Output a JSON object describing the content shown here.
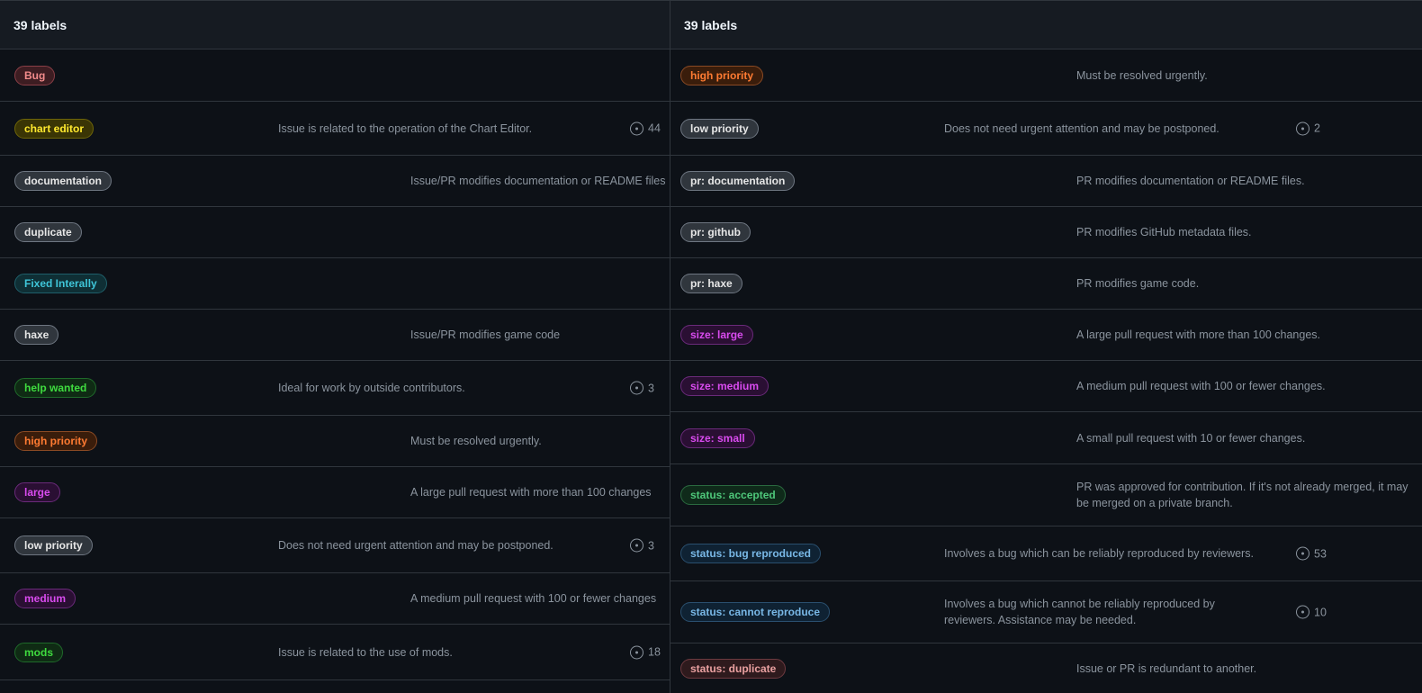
{
  "left_panel": {
    "title": "39 labels",
    "rows": [
      {
        "label": "Bug",
        "description": "",
        "count": ""
      },
      {
        "label": "chart editor",
        "description": "Issue is related to the operation of the Chart Editor.",
        "count": "44"
      },
      {
        "label": "documentation",
        "description": "Issue/PR modifies documentation or README files",
        "count": ""
      },
      {
        "label": "duplicate",
        "description": "",
        "count": ""
      },
      {
        "label": "Fixed Interally",
        "description": "",
        "count": ""
      },
      {
        "label": "haxe",
        "description": "Issue/PR modifies game code",
        "count": ""
      },
      {
        "label": "help wanted",
        "description": "Ideal for work by outside contributors.",
        "count": "3"
      },
      {
        "label": "high priority",
        "description": "Must be resolved urgently.",
        "count": ""
      },
      {
        "label": "large",
        "description": "A large pull request with more than 100 changes",
        "count": ""
      },
      {
        "label": "low priority",
        "description": "Does not need urgent attention and may be postponed.",
        "count": "3"
      },
      {
        "label": "medium",
        "description": "A medium pull request with 100 or fewer changes",
        "count": ""
      },
      {
        "label": "mods",
        "description": "Issue is related to the use of mods.",
        "count": "18"
      }
    ]
  },
  "right_panel": {
    "title": "39 labels",
    "rows": [
      {
        "label": "high priority",
        "description": "Must be resolved urgently.",
        "count": ""
      },
      {
        "label": "low priority",
        "description": "Does not need urgent attention and may be postponed.",
        "count": "2"
      },
      {
        "label": "pr: documentation",
        "description": "PR modifies documentation or README files.",
        "count": ""
      },
      {
        "label": "pr: github",
        "description": "PR modifies GitHub metadata files.",
        "count": ""
      },
      {
        "label": "pr: haxe",
        "description": "PR modifies game code.",
        "count": ""
      },
      {
        "label": "size: large",
        "description": "A large pull request with more than 100 changes.",
        "count": ""
      },
      {
        "label": "size: medium",
        "description": "A medium pull request with 100 or fewer changes.",
        "count": ""
      },
      {
        "label": "size: small",
        "description": "A small pull request with 10 or fewer changes.",
        "count": ""
      },
      {
        "label": "status: accepted",
        "description": "PR was approved for contribution. If it's not already merged, it may be merged on a private branch.",
        "count": ""
      },
      {
        "label": "status: bug reproduced",
        "description": "Involves a bug which can be reliably reproduced by reviewers.",
        "count": "53"
      },
      {
        "label": "status: cannot reproduce",
        "description": "Involves a bug which cannot be reliably reproduced by reviewers. Assistance may be needed.",
        "count": "10"
      },
      {
        "label": "status: duplicate",
        "description": "Issue or PR is redundant to another.",
        "count": ""
      }
    ]
  },
  "icons": {
    "count_icon": "issue-opened-icon"
  },
  "colors": {
    "background": "#0d1117",
    "header_background": "#161b22",
    "border": "#30363d",
    "muted_text": "#8b949e"
  }
}
